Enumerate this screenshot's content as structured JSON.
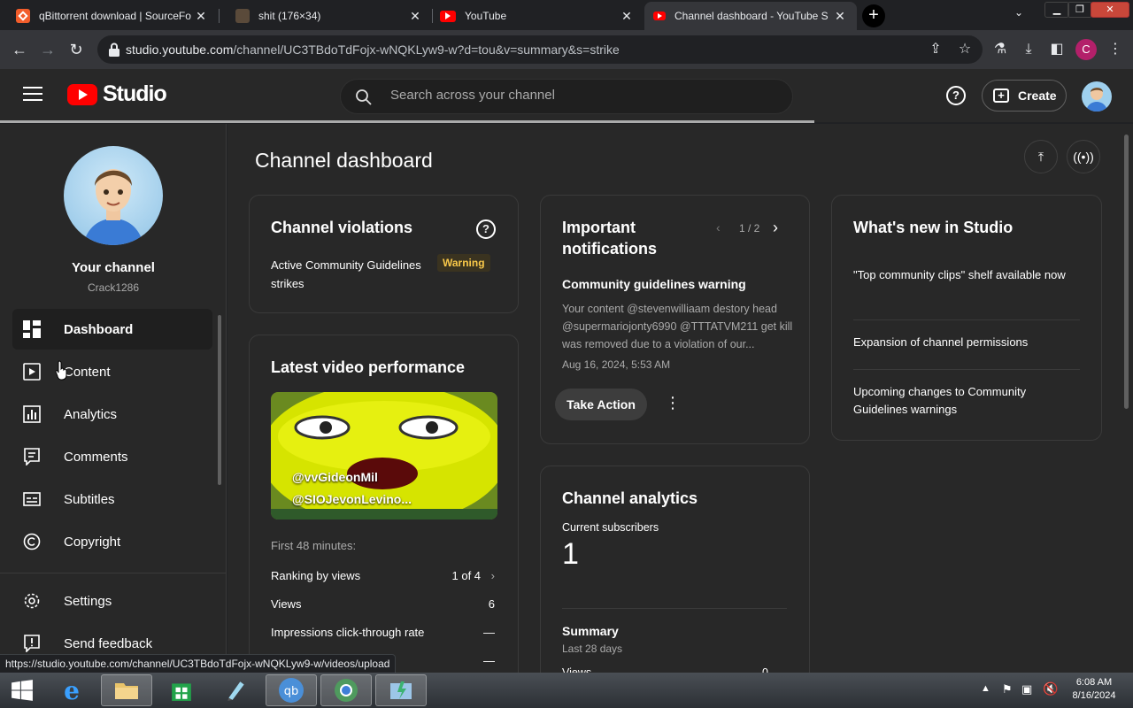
{
  "browser": {
    "tabs": [
      {
        "title": "qBittorrent download | SourceFo",
        "favicon": "sourceforge-icon"
      },
      {
        "title": "shit (176×34)",
        "favicon": "image-icon"
      },
      {
        "title": "YouTube",
        "favicon": "youtube-icon"
      },
      {
        "title": "Channel dashboard - YouTube S",
        "favicon": "youtube-icon",
        "active": true
      }
    ],
    "url_host": "studio.youtube.com",
    "url_path": "/channel/UC3TBdoTdFojx-wNQKLyw9-w?d=tou&v=summary&s=strike",
    "profile_initial": "C",
    "status_url": "https://studio.youtube.com/channel/UC3TBdoTdFojx-wNQKLyw9-w/videos/upload"
  },
  "header": {
    "logo_text": "Studio",
    "search_placeholder": "Search across your channel",
    "help": "?",
    "create_label": "Create"
  },
  "sidebar": {
    "channel_title": "Your channel",
    "channel_handle": "Crack1286",
    "items": [
      {
        "label": "Dashboard",
        "icon": "dashboard-icon"
      },
      {
        "label": "Content",
        "icon": "content-icon"
      },
      {
        "label": "Analytics",
        "icon": "analytics-icon"
      },
      {
        "label": "Comments",
        "icon": "comments-icon"
      },
      {
        "label": "Subtitles",
        "icon": "subtitles-icon"
      },
      {
        "label": "Copyright",
        "icon": "copyright-icon"
      },
      {
        "label": "Settings",
        "icon": "settings-icon"
      },
      {
        "label": "Send feedback",
        "icon": "feedback-icon"
      }
    ]
  },
  "main": {
    "title": "Channel dashboard",
    "violations": {
      "title": "Channel violations",
      "text": "Active Community Guidelines strikes",
      "badge": "Warning"
    },
    "latest": {
      "title": "Latest video performance",
      "thumb_line1": "@vvGideonMil",
      "thumb_line2": "@SIOJevonLevino...",
      "period": "First 48 minutes:",
      "rows": [
        {
          "label": "Ranking by views",
          "value": "1 of 4"
        },
        {
          "label": "Views",
          "value": "6"
        },
        {
          "label": "Impressions click-through rate",
          "value": "—"
        },
        {
          "label": "",
          "value": "—"
        }
      ]
    },
    "notifications": {
      "title": "Important notifications",
      "pager": "1 / 2",
      "item_title": "Community guidelines warning",
      "item_body": "Your content @stevenwilliaam destory head @supermariojonty6990 @TTTATVM211 get kill was removed due to a violation of our...",
      "item_date": "Aug 16, 2024, 5:53 AM",
      "action_label": "Take Action"
    },
    "analytics": {
      "title": "Channel analytics",
      "subs_label": "Current subscribers",
      "subs_value": "1",
      "summary_title": "Summary",
      "summary_period": "Last 28 days",
      "summary_row_label": "Views",
      "summary_row_value": "0"
    },
    "whats_new": {
      "title": "What's new in Studio",
      "items": [
        "\"Top community clips\" shelf available now",
        "Expansion of channel permissions",
        "Upcoming changes to Community Guidelines warnings"
      ]
    }
  },
  "taskbar": {
    "time": "6:08 AM",
    "date": "8/16/2024"
  },
  "colors": {
    "accent_red": "#ff0000",
    "warning": "#f9c849",
    "bg": "#282828"
  }
}
